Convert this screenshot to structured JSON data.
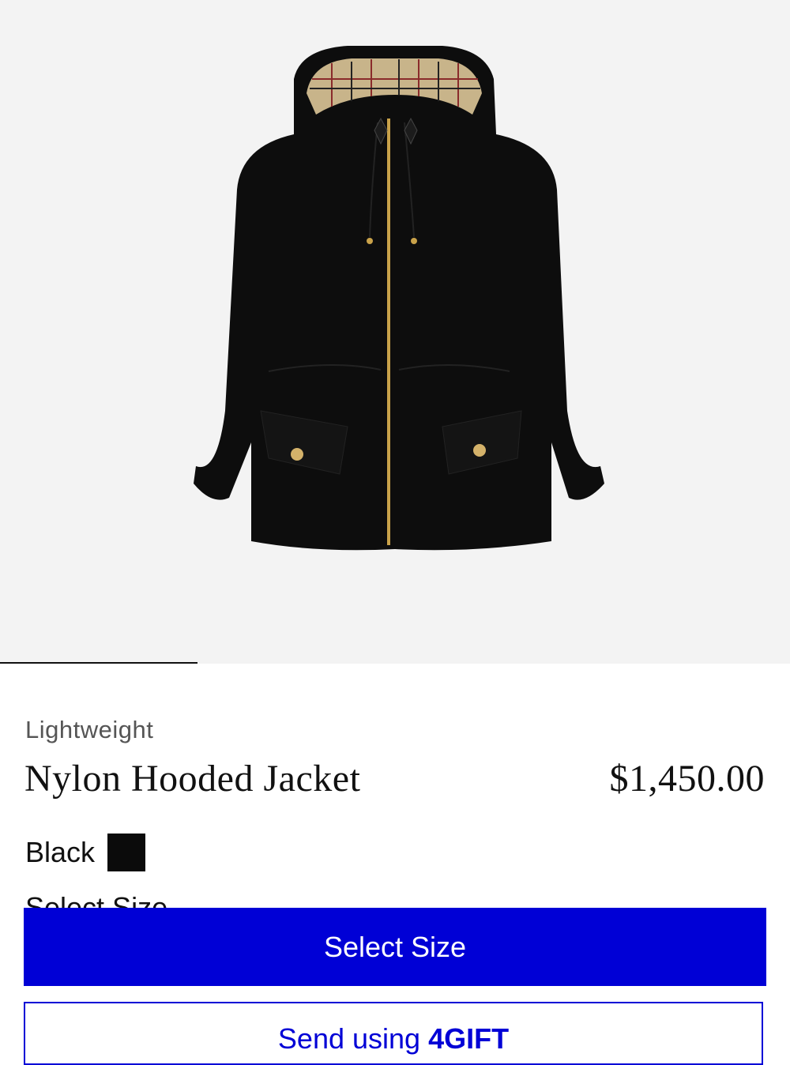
{
  "product": {
    "image_alt": "Nylon Hooded Jacket",
    "category": "Lightweight",
    "title": "Nylon Hooded Jacket",
    "price": "$1,450.00",
    "color_name": "Black",
    "color_hex": "#0b0b0b",
    "size_label": "Select Size"
  },
  "actions": {
    "select_size": "Select Size",
    "send_using": "Send using",
    "gift_icon": "4",
    "gift_brand": "GIFT"
  },
  "colors": {
    "accent": "#0000d6",
    "hero_bg": "#f3f3f3"
  }
}
